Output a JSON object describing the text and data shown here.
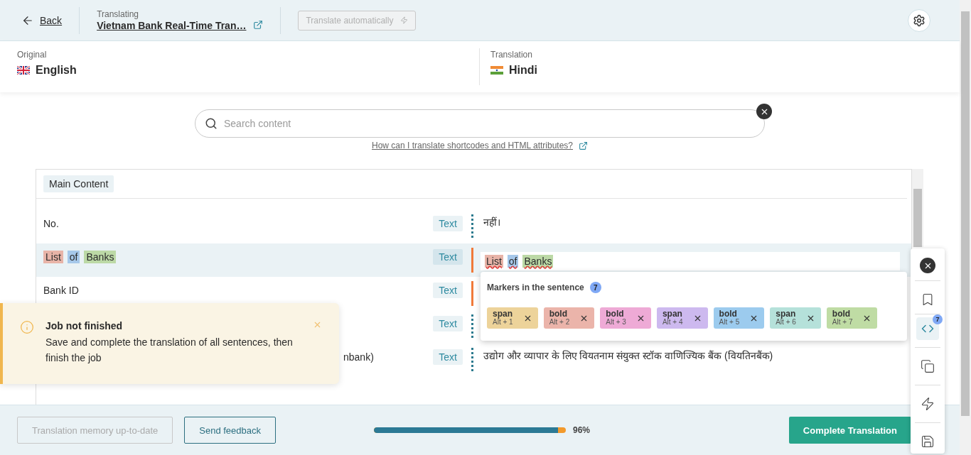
{
  "header": {
    "back": "Back",
    "translating_label": "Translating",
    "project_title": "Vietnam Bank Real-Time Tran…",
    "auto_translate": {
      "label": "Translate automatically",
      "disabled": true
    }
  },
  "languages": {
    "original": {
      "label": "Original",
      "name": "English"
    },
    "translation": {
      "label": "Translation",
      "name": "Hindi"
    }
  },
  "search": {
    "placeholder": "Search content"
  },
  "help_link": "How can I translate shortcodes and HTML attributes?",
  "section": "Main Content",
  "rows": [
    {
      "source": [
        {
          "text": "No."
        }
      ],
      "type": "Text",
      "edited": false,
      "selected": false,
      "translation": [
        {
          "text": "नहीं।"
        }
      ]
    },
    {
      "source": [
        {
          "text": "List",
          "color": "#e8b4a8"
        },
        {
          "text": "of",
          "color": "#a6c8ea"
        },
        {
          "text": "Banks",
          "color": "#bcd9a6"
        }
      ],
      "type": "Text",
      "edited": true,
      "selected": true,
      "editing": true,
      "translation": [
        {
          "text": "List",
          "color": "#e8b4a8"
        },
        {
          "text": "of",
          "color": "#a6c8ea"
        },
        {
          "text": "Banks",
          "color": "#bcd9a6"
        }
      ]
    },
    {
      "source": [
        {
          "text": "Bank ID"
        }
      ],
      "type": "Text",
      "edited": true,
      "selected": false
    },
    {
      "type": "Text",
      "edited": false,
      "selected": false
    },
    {
      "source": [
        {
          "text": "nbank)"
        }
      ],
      "partial": true,
      "type": "Text",
      "edited": false,
      "selected": false,
      "translation": [
        {
          "text": "उद्योग और व्यापार के लिए वियतनाम संयुक्त स्टॉक वाणिज्यिक बैंक (वियतिनबैंक)"
        }
      ]
    }
  ],
  "markers_popup": {
    "title": "Markers in the sentence",
    "count": "7",
    "markers": [
      {
        "tag": "span",
        "shortcut": "Alt + 1",
        "color": "#edd39a"
      },
      {
        "tag": "bold",
        "shortcut": "Alt + 2",
        "color": "#ebb4aa"
      },
      {
        "tag": "bold",
        "shortcut": "Alt + 3",
        "color": "#eeaad6"
      },
      {
        "tag": "span",
        "shortcut": "Alt + 4",
        "color": "#cdb9ef"
      },
      {
        "tag": "bold",
        "shortcut": "Alt + 5",
        "color": "#9ccbee"
      },
      {
        "tag": "span",
        "shortcut": "Alt + 6",
        "color": "#b5e1da"
      },
      {
        "tag": "bold",
        "shortcut": "Alt + 7",
        "color": "#bfdca4"
      }
    ]
  },
  "side_toolbar": {
    "markers_count": "7",
    "markers_active": true
  },
  "toast": {
    "title": "Job not finished",
    "message": "Save and complete the translation of all sentences, then finish the job"
  },
  "footer": {
    "memory_button": {
      "label": "Translation memory up-to-date",
      "disabled": true
    },
    "feedback_button": "Send feedback",
    "progress": {
      "level": 0.96,
      "reading": "96%"
    },
    "complete_button": "Complete Translation"
  }
}
